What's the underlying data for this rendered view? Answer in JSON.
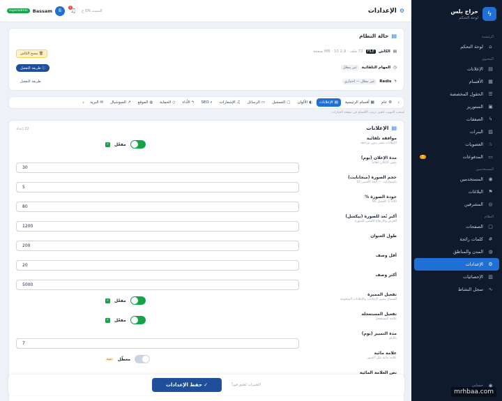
{
  "brand": {
    "name": "حراج بلس",
    "subtitle": "لوحة التحكم"
  },
  "sidebar": {
    "sections": [
      {
        "title": "الرئيسية",
        "items": [
          {
            "label": "لوحة التحكم",
            "icon": "⌂"
          }
        ]
      },
      {
        "title": "المحتوى",
        "items": [
          {
            "label": "الإعلانات",
            "icon": "▤"
          },
          {
            "label": "الأقسام",
            "icon": "▦"
          },
          {
            "label": "الحقول المخصصة",
            "icon": "☰"
          },
          {
            "label": "الستوريز",
            "icon": "▣"
          },
          {
            "label": "الصفقات",
            "icon": "ϟ"
          },
          {
            "label": "البنرات",
            "icon": "▨"
          },
          {
            "label": "العضويات",
            "icon": "☆"
          },
          {
            "label": "المدفوعات",
            "icon": "▭",
            "badge": "1"
          }
        ]
      },
      {
        "title": "المستخدمين",
        "items": [
          {
            "label": "المستخدمين",
            "icon": "◉"
          },
          {
            "label": "البلاغات",
            "icon": "⚑"
          },
          {
            "label": "المشرفين",
            "icon": "◎"
          }
        ]
      },
      {
        "title": "النظام",
        "items": [
          {
            "label": "الصفحات",
            "icon": "▢"
          },
          {
            "label": "كلمات رائجة",
            "icon": "#"
          },
          {
            "label": "المدن والمناطق",
            "icon": "◍"
          },
          {
            "label": "الإعدادات",
            "icon": "⚙",
            "active": true
          },
          {
            "label": "الإحصائيات",
            "icon": "▥"
          },
          {
            "label": "سجل النشاط",
            "icon": "∿"
          }
        ]
      }
    ],
    "bottom": [
      {
        "label": "حسابي",
        "icon": "◉"
      }
    ]
  },
  "header": {
    "title": "الإعدادات",
    "user_name": "Bassam",
    "user_initial": "B",
    "user_role": "superadmin",
    "notif_count": "1",
    "lang_label": "السيت EN ع"
  },
  "status": {
    "title": "حالة النظام",
    "clear_label": "مسح الكاش",
    "cache_label": "الكاش",
    "cache_driver": "FILE",
    "cache_meta": "72 ملف · 2.9 MB · 10 صفحة",
    "tasks_label": "المهام التلقائية",
    "tasks_state": "غير مفعّل",
    "tasks_btn": "طريقة التفعيل",
    "redis_label": "Redis",
    "redis_state": "غير مفعّل — اختياري",
    "redis_btn": "طريقة التفعيل"
  },
  "tabs": [
    {
      "label": "عام",
      "icon": "⚙"
    },
    {
      "label": "أقسام الرئيسية",
      "icon": "▦"
    },
    {
      "label": "الإعلانات",
      "icon": "▤",
      "active": true
    },
    {
      "label": "الألوان",
      "icon": "◐"
    },
    {
      "label": "التسجيل",
      "icon": "▢"
    },
    {
      "label": "الرسائل",
      "icon": "▭"
    },
    {
      "label": "الإشعارات",
      "icon": "♫"
    },
    {
      "label": "SEO",
      "icon": "⌕"
    },
    {
      "label": "الأداء",
      "icon": "ϟ"
    },
    {
      "label": "الحماية",
      "icon": "◇"
    },
    {
      "label": "الموقع",
      "icon": "◍"
    },
    {
      "label": "السوشيال",
      "icon": "↗"
    },
    {
      "label": "البريد",
      "icon": "✉"
    }
  ],
  "hint": "اسحب التبويب لتغيير ترتيب الأقسام في صفحة الخيارات",
  "settings": {
    "title": "الإعلانات",
    "count": "22 إعداد",
    "rows": [
      {
        "label": "موافقة تلقائية",
        "desc": "الإعلانات تنشر بدون مراجعة",
        "type": "toggle",
        "state": "مفعّل",
        "on": true
      },
      {
        "label": "مدة الإعلان (يوم)",
        "desc": "ينتهي الإعلان تلقائياً",
        "type": "input",
        "value": "30"
      },
      {
        "label": "حجم الصورة (ميجابايت)",
        "desc": "بالميجابايت — الحد الأقصى 10",
        "type": "input",
        "value": "5"
      },
      {
        "label": "جودة الصورة %",
        "desc": "1-100 الأفضل 80",
        "type": "input",
        "value": "80"
      },
      {
        "label": "أكبر بُعد للصورة (بيكسل)",
        "desc": "العرض والارتفاع الأقصى للصورة",
        "type": "input",
        "value": "1200"
      },
      {
        "label": "طول العنوان",
        "desc": "",
        "type": "input",
        "value": "200"
      },
      {
        "label": "أقل وصف",
        "desc": "",
        "type": "input",
        "value": "20"
      },
      {
        "label": "أكثر وصف",
        "desc": "",
        "type": "input",
        "value": "5000"
      },
      {
        "label": "تفعيل المميزة",
        "desc": "السماح بتمييز الإعلانات والإعلانات المدفوعة",
        "type": "toggle",
        "state": "مفعّل",
        "on": true
      },
      {
        "label": "تفعيل المستعجلة",
        "desc": "علامة المستعجل",
        "type": "toggle",
        "state": "مفعّل",
        "on": true
      },
      {
        "label": "مدة التمييز (يوم)",
        "desc": "بالأيام",
        "type": "input",
        "value": "7"
      },
      {
        "label": "علامة مائية",
        "desc": "علامة مائية على الصور",
        "type": "toggle",
        "state": "معطّل",
        "on": false,
        "warn": "تنبيه"
      },
      {
        "label": "نص العلامة المائية",
        "desc": "",
        "type": "input",
        "value": ""
      }
    ]
  },
  "savebar": {
    "save_label": "حفظ الإعدادات",
    "unsaved": "التغييرات تُطبق فوراً"
  },
  "watermark": "mrhbaa.com"
}
